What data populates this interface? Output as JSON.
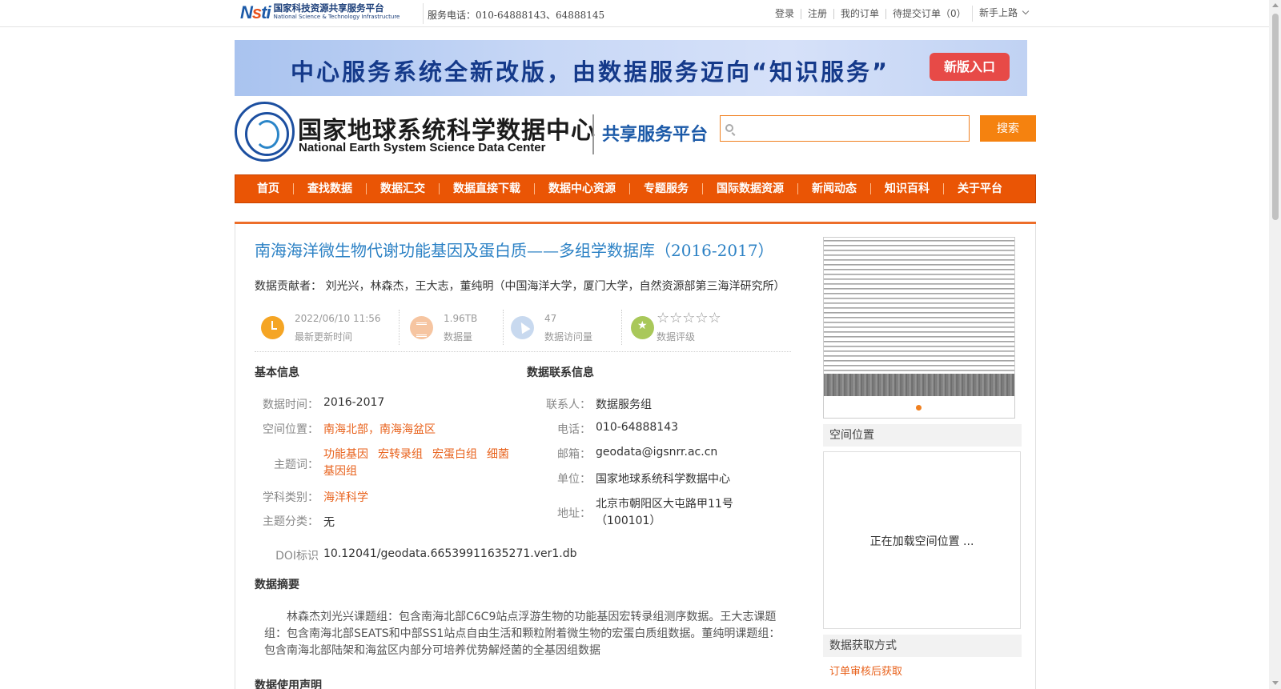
{
  "topbar": {
    "logo_cn": "国家科技资源共享服务平台",
    "logo_en": "National Science & Technology Infrastructure",
    "service_phone": "服务电话：010-64888143、64888145",
    "links": [
      "登录",
      "注册",
      "我的订单",
      "待提交订单（0）"
    ],
    "newbie": "新手上路"
  },
  "banner": {
    "text": "中心服务系统全新改版，由数据服务迈向“知识服务”",
    "button": "新版入口"
  },
  "header": {
    "center_cn": "国家地球系统科学数据中心",
    "center_en": "National Earth System Science Data Center",
    "platform": "共享服务平台",
    "search_placeholder": "",
    "search_button": "搜索"
  },
  "nav": [
    "首页",
    "查找数据",
    "数据汇交",
    "数据直接下载",
    "数据中心资源",
    "专题服务",
    "国际数据资源",
    "新闻动态",
    "知识百科",
    "关于平台"
  ],
  "dataset": {
    "title": "南海海洋微生物代谢功能基因及蛋白质——多组学数据库（2016-2017）",
    "contributors_label": "数据贡献者：",
    "contributors": "刘光兴，林森杰，王大志，董纯明（中国海洋大学，厦门大学，自然资源部第三海洋研究所）"
  },
  "stats": {
    "update_time": "2022/06/10 11:56",
    "update_label": "最新更新时间",
    "volume": "1.96TB",
    "volume_label": "数据量",
    "visits": "47",
    "visits_label": "数据访问量",
    "stars": "☆☆☆☆☆",
    "rating_label": "数据评级"
  },
  "basic_info": {
    "title": "基本信息",
    "time_label": "数据时间：",
    "time": "2016-2017",
    "location_label": "空间位置：",
    "location": "南海北部，南海海盆区",
    "keywords_label": "主题词：",
    "keywords": [
      "功能基因",
      "宏转录组",
      "宏蛋白组",
      "细菌",
      "基因组"
    ],
    "discipline_label": "学科类别：",
    "discipline": "海洋科学",
    "category_label": "主题分类：",
    "category": "无",
    "doi_label": "DOI标识",
    "doi": "10.12041/geodata.66539911635271.ver1.db"
  },
  "contact_info": {
    "title": "数据联系信息",
    "contact_label": "联系人：",
    "contact": "数据服务组",
    "phone_label": "电话：",
    "phone": "010-64888143",
    "email_label": "邮箱：",
    "email": "geodata@igsnrr.ac.cn",
    "org_label": "单位：",
    "org": "国家地球系统科学数据中心",
    "address_label": "地址：",
    "address_line1": "北京市朝阳区大屯路甲11号",
    "address_line2": "（100101）"
  },
  "abstract": {
    "title": "数据摘要",
    "text": "林森杰刘光兴课题组：包含南海北部C6C9站点浮游生物的功能基因宏转录组测序数据。王大志课题组：包含南海北部SEATS和中部SS1站点自由生活和颗粒附着微生物的宏蛋白质组数据。董纯明课题组：包含南海北部陆架和海盆区内部分可培养优势解烃菌的全基因组数据"
  },
  "usage": {
    "title": "数据使用声明"
  },
  "sidebar": {
    "spatial_title": "空间位置",
    "spatial_loading": "正在加载空间位置 ...",
    "access_title": "数据获取方式",
    "access_link": "订单审核后获取"
  }
}
